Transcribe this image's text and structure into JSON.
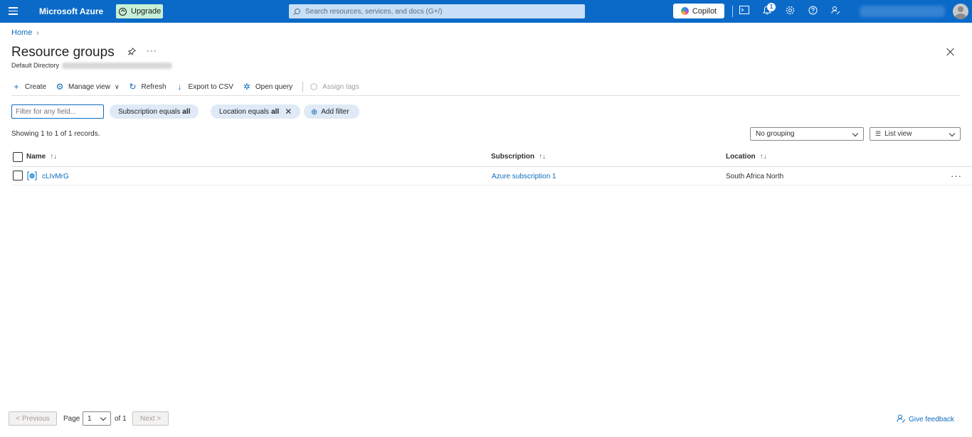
{
  "topbar": {
    "brand": "Microsoft Azure",
    "upgrade_label": "Upgrade",
    "search_placeholder": "Search resources, services, and docs (G+/)",
    "copilot_label": "Copilot",
    "notifications_count": "1",
    "icons": [
      "menu-icon",
      "cloud-shell-icon",
      "notifications-icon",
      "settings-icon",
      "help-icon",
      "feedback-icon",
      "avatar"
    ]
  },
  "breadcrumb": {
    "home": "Home"
  },
  "page": {
    "title": "Resource groups",
    "subtitle": "Default Directory"
  },
  "toolbar": {
    "create": "Create",
    "manage_view": "Manage view",
    "refresh": "Refresh",
    "export_csv": "Export to CSV",
    "open_query": "Open query",
    "assign_tags": "Assign tags"
  },
  "filters": {
    "placeholder": "Filter for any field...",
    "subscription_prefix": "Subscription equals",
    "subscription_value": "all",
    "location_prefix": "Location equals",
    "location_value": "all",
    "add_filter": "Add filter"
  },
  "records_text": "Showing 1 to 1 of 1 records.",
  "grouping": "No grouping",
  "view": "List view",
  "table": {
    "columns": {
      "name": "Name",
      "subscription": "Subscription",
      "location": "Location"
    },
    "rows": [
      {
        "name": "cLIvMrG",
        "subscription": "Azure subscription 1",
        "location": "South Africa North"
      }
    ]
  },
  "pagination": {
    "previous": "< Previous",
    "page_label": "Page",
    "page_value": "1",
    "of_label": "of 1",
    "next": "Next >"
  },
  "feedback": "Give feedback",
  "colors": {
    "topbar": "#0b6ac8",
    "accent": "#0f6cbd",
    "upgrade_bg": "#c7f0d6",
    "pill_bg": "#dfeaf6"
  }
}
